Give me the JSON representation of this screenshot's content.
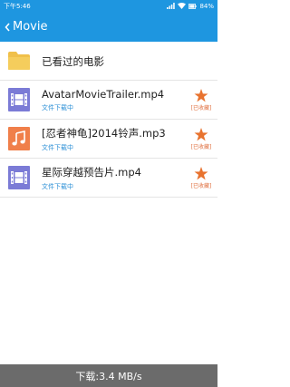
{
  "status_bar": {
    "time": "下午5:46",
    "battery": "84%",
    "icons": [
      "signal-icon",
      "wifi-icon",
      "battery-icon"
    ]
  },
  "header": {
    "back_icon": "back-chevron-icon",
    "title": "Movie"
  },
  "items": [
    {
      "type": "folder",
      "icon": "folder-icon",
      "title": "已看过的电影",
      "color": "#f0c04a"
    },
    {
      "type": "video",
      "icon": "video-file-icon",
      "title": "AvatarMovieTrailer.mp4",
      "subtitle": "文件下载中",
      "favorite_label": "[已收藏]",
      "color": "#7b7bd6"
    },
    {
      "type": "audio",
      "icon": "music-file-icon",
      "title": "[忍者神龟]2014铃声.mp3",
      "subtitle": "文件下载中",
      "favorite_label": "[已收藏]",
      "color": "#f07f4a"
    },
    {
      "type": "video",
      "icon": "video-file-icon",
      "title": "星际穿越预告片.mp4",
      "subtitle": "文件下载中",
      "favorite_label": "[已收藏]",
      "color": "#7b7bd6"
    }
  ],
  "footer": {
    "download_speed": "下载:3.4 MB/s"
  },
  "colors": {
    "primary": "#1e96e0",
    "star": "#e8732f",
    "subtitle": "#2b8fd6",
    "footer_bg": "#6b6b6b"
  }
}
